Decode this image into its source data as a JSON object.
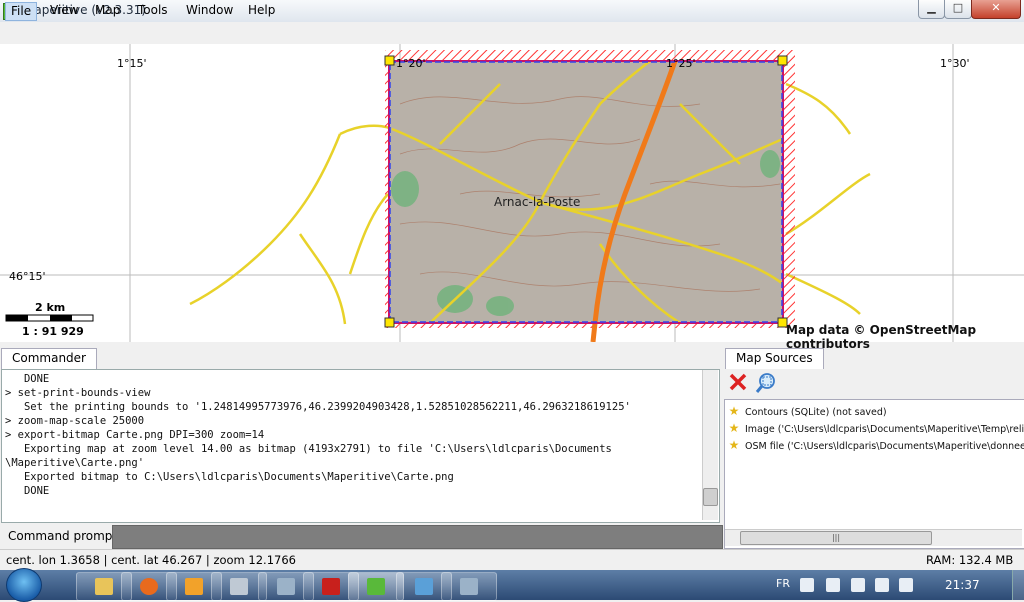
{
  "window": {
    "app_icon_letter": "m",
    "title": "Maperitive (v2.3.31)",
    "min_label": "▁",
    "max_label": "□",
    "close_label": "✕"
  },
  "menu": {
    "file": "File",
    "view": "View",
    "map": "Map",
    "tools": "Tools",
    "window": "Window",
    "help": "Help"
  },
  "map": {
    "lon_labels": [
      "1°15'",
      "1°20'",
      "1°25'",
      "1°30'"
    ],
    "lat_label": "46°15'",
    "town_label": "Arnac-la-Poste",
    "scale_distance": "2 km",
    "scale_ratio": "1 : 91 929",
    "credit": "Map data © OpenStreetMap contributors",
    "colors": {
      "print_border": "#cc1166",
      "print_bounds_dash": "#3344ee",
      "main_road": "#f07a1a",
      "secondary_road": "#e8d22a",
      "hatch": "#ff3333"
    }
  },
  "commander": {
    "tab_label": "Commander",
    "lines": [
      "   DONE",
      "> set-print-bounds-view",
      "   Set the printing bounds to '1.24814995773976,46.2399204903428,1.52851028562211,46.2963218619125'",
      "> zoom-map-scale 25000",
      "> export-bitmap Carte.png DPI=300 zoom=14",
      "   Exporting map at zoom level 14.00 as bitmap (4193x2791) to file 'C:\\Users\\ldlcparis\\Documents",
      "\\Maperitive\\Carte.png'",
      "   Exported bitmap to C:\\Users\\ldlcparis\\Documents\\Maperitive\\Carte.png",
      "   DONE"
    ],
    "prompt_label": "Command prompt:",
    "prompt_value": ""
  },
  "sources": {
    "tab_label": "Map Sources",
    "items": [
      "Contours (SQLite) (not saved)",
      "Image ('C:\\Users\\ldlcparis\\Documents\\Maperitive\\Temp\\relief_",
      "OSM file ('C:\\Users\\ldlcparis\\Documents\\Maperitive\\donnees.o"
    ],
    "hscroll_grip": "|||"
  },
  "status": {
    "left": "cent. lon 1.3658 | cent. lat 46.267 | zoom 12.1766",
    "ram": "RAM: 132.4 MB"
  },
  "taskbar": {
    "lang": "FR",
    "time": "21:37",
    "apps": [
      "explorer",
      "firefox",
      "media-player",
      "paint",
      "acrobat-reader",
      "maperitive",
      "screenshot",
      "tool"
    ]
  }
}
